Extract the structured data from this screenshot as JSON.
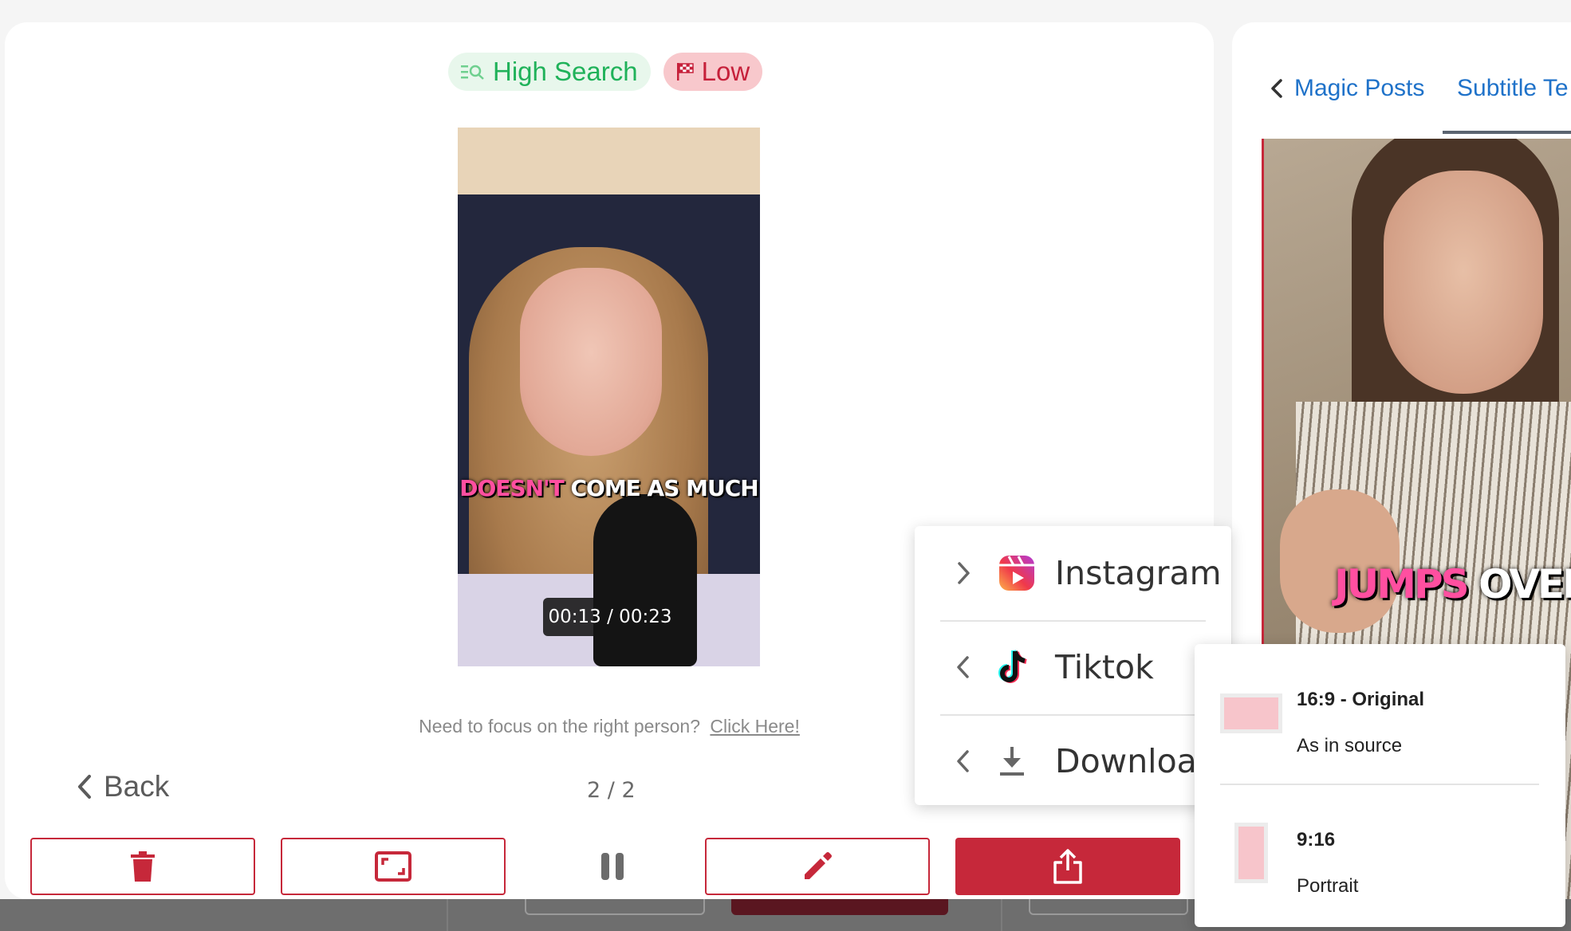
{
  "badges": {
    "search_label": "High Search",
    "priority_label": "Low"
  },
  "video": {
    "caption_highlight": "DOESN'T",
    "caption_rest": "COME AS MUCH",
    "timestamp": "00:13 / 00:23"
  },
  "focus_hint": {
    "text": "Need to focus on the right person?",
    "link": "Click Here!"
  },
  "nav": {
    "back_label": "Back",
    "page_indicator": "2 / 2"
  },
  "toolbar": {
    "delete_icon": "trash-icon",
    "crop_icon": "aspect-ratio-icon",
    "pause_icon": "pause-icon",
    "edit_icon": "pencil-icon",
    "share_icon": "share-icon"
  },
  "right_panel": {
    "back_tab": "Magic Posts",
    "active_tab": "Subtitle Te",
    "caption_highlight": "JUMPS",
    "caption_rest": "OVER TH"
  },
  "share_menu": {
    "items": [
      {
        "label": "Instagram",
        "icon": "instagram-reels-icon",
        "chevron": "right"
      },
      {
        "label": "Tiktok",
        "icon": "tiktok-icon",
        "chevron": "left"
      },
      {
        "label": "Download",
        "icon": "download-icon",
        "chevron": "left"
      }
    ]
  },
  "ratio_menu": {
    "items": [
      {
        "title": "16:9 - Original",
        "subtitle": "As in source"
      },
      {
        "title": "9:16",
        "subtitle": "Portrait"
      }
    ]
  },
  "colors": {
    "brand_red": "#c6283a",
    "link_blue": "#1f72c9",
    "search_green": "#20b25a",
    "low_pink_bg": "#f8c8cc"
  }
}
